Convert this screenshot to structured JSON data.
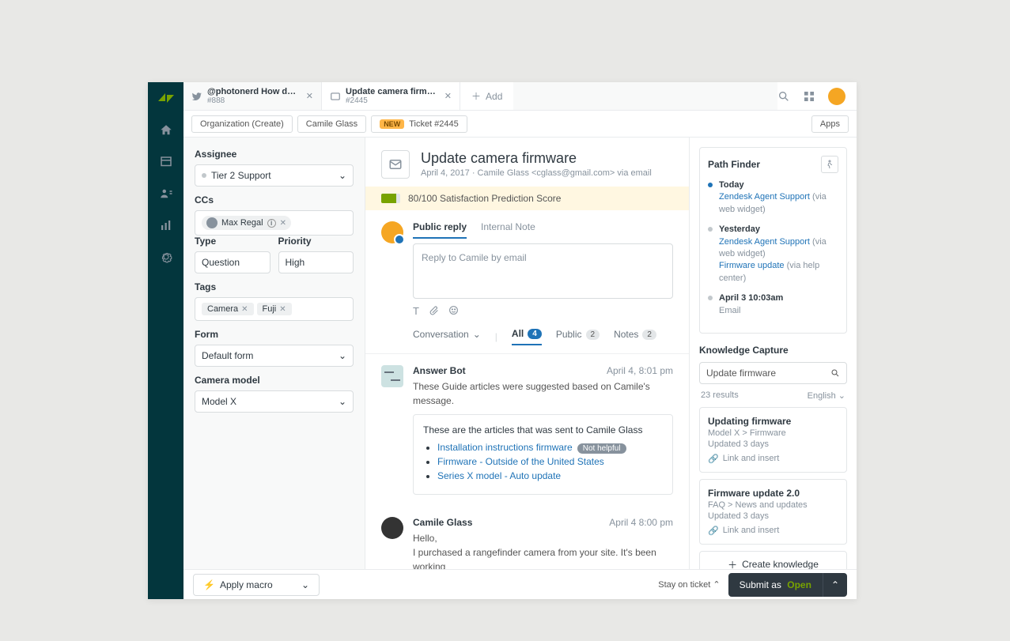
{
  "tabs": [
    {
      "title": "@photonerd How do I reset...",
      "sub": "#888"
    },
    {
      "title": "Update camera firmware",
      "sub": "#2445"
    }
  ],
  "add_tab_label": "Add",
  "breadcrumb": {
    "org": "Organization (Create)",
    "user": "Camile Glass",
    "new_badge": "NEW",
    "ticket": "Ticket #2445",
    "apps_btn": "Apps"
  },
  "left": {
    "assignee_label": "Assignee",
    "assignee_value": "Tier 2 Support",
    "ccs_label": "CCs",
    "cc_name": "Max Regal",
    "type_label": "Type",
    "type_value": "Question",
    "priority_label": "Priority",
    "priority_value": "High",
    "tags_label": "Tags",
    "tags": [
      "Camera",
      "Fuji"
    ],
    "form_label": "Form",
    "form_value": "Default form",
    "camera_label": "Camera model",
    "camera_value": "Model X"
  },
  "ticket": {
    "title": "Update camera firmware",
    "sub": "April 4, 2017 · Camile Glass <cglass@gmail.com> via email",
    "score_text": "80/100 Satisfaction Prediction Score",
    "score_pct": 80
  },
  "reply": {
    "tab_public": "Public reply",
    "tab_internal": "Internal Note",
    "placeholder": "Reply to Camile by email"
  },
  "conv": {
    "conversation": "Conversation",
    "all": "All",
    "all_count": "4",
    "public": "Public",
    "public_count": "2",
    "notes": "Notes",
    "notes_count": "2"
  },
  "bot": {
    "name": "Answer Bot",
    "time": "April 4, 8:01 pm",
    "intro": "These Guide articles were suggested based on Camile's message.",
    "sent_to": "These are the articles that was sent to Camile Glass",
    "articles": [
      {
        "text": "Installation instructions firmware",
        "badge": "Not helpful"
      },
      {
        "text": "Firmware - Outside of the United States"
      },
      {
        "text": "Series X model - Auto update"
      }
    ]
  },
  "customer": {
    "name": "Camile Glass",
    "time": "April 4 8:00 pm",
    "hello": "Hello,",
    "body": "I purchased a rangefinder camera from your site. It's been working"
  },
  "path": {
    "title": "Path Finder",
    "items": [
      {
        "day": "Today",
        "links": [
          {
            "text": "Zendesk Agent Support",
            "via": "(via web widget)"
          }
        ]
      },
      {
        "day": "Yesterday",
        "links": [
          {
            "text": "Zendesk Agent Support",
            "via": "(via web widget)"
          },
          {
            "text": "Firmware update",
            "via": "(via help center)"
          }
        ]
      },
      {
        "day": "April 3 10:03am",
        "links": [
          {
            "plain": "Email"
          }
        ]
      }
    ]
  },
  "kc": {
    "title": "Knowledge Capture",
    "search_value": "Update firmware",
    "results": "23 results",
    "lang": "English",
    "cards": [
      {
        "t": "Updating firmware",
        "p": "Model X > Firmware",
        "u": "Updated 3 days",
        "li": "Link and insert"
      },
      {
        "t": "Firmware update 2.0",
        "p": "FAQ > News and updates",
        "u": "Updated 3 days",
        "li": "Link and insert"
      }
    ],
    "create": "Create knowledge"
  },
  "footer": {
    "macro": "Apply macro",
    "stay": "Stay on ticket",
    "submit": "Submit as",
    "status": "Open"
  }
}
